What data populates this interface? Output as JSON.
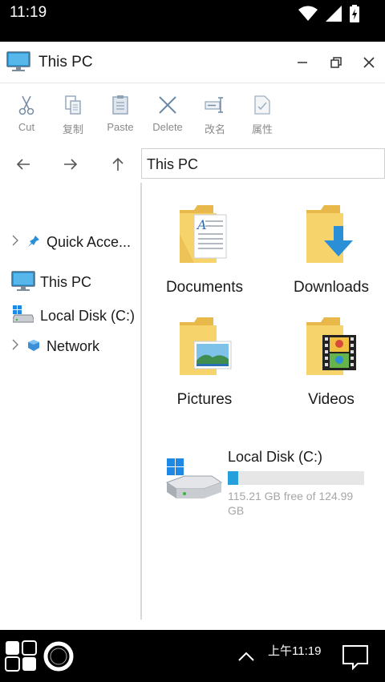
{
  "status_bar": {
    "time": "11:19"
  },
  "window": {
    "title": "This PC"
  },
  "toolbar": {
    "items": [
      {
        "label": "Cut",
        "icon": "scissors-icon"
      },
      {
        "label": "复制",
        "icon": "copy-icon"
      },
      {
        "label": "Paste",
        "icon": "paste-icon"
      },
      {
        "label": "Delete",
        "icon": "delete-icon"
      },
      {
        "label": "改名",
        "icon": "rename-icon"
      },
      {
        "label": "属性",
        "icon": "properties-icon"
      }
    ]
  },
  "address_bar": {
    "value": "This PC"
  },
  "sidebar": {
    "items": [
      {
        "label": "Quick Acce...",
        "icon": "pin-icon"
      },
      {
        "label": "This PC",
        "icon": "monitor-icon"
      },
      {
        "label": "Local Disk (C:)",
        "icon": "drive-icon"
      },
      {
        "label": "Network",
        "icon": "network-icon"
      }
    ]
  },
  "content": {
    "folders": [
      {
        "label": "Documents",
        "icon": "documents-folder-icon"
      },
      {
        "label": "Downloads",
        "icon": "downloads-folder-icon"
      },
      {
        "label": "Pictures",
        "icon": "pictures-folder-icon"
      },
      {
        "label": "Videos",
        "icon": "videos-folder-icon"
      }
    ],
    "disk": {
      "name": "Local Disk (C:)",
      "free_text": "115.21 GB free of 124.99 GB",
      "used_fraction": 0.078
    }
  },
  "taskbar": {
    "clock": "上午11:19"
  },
  "colors": {
    "accent": "#26a0da",
    "folder": "#f6d36b"
  }
}
